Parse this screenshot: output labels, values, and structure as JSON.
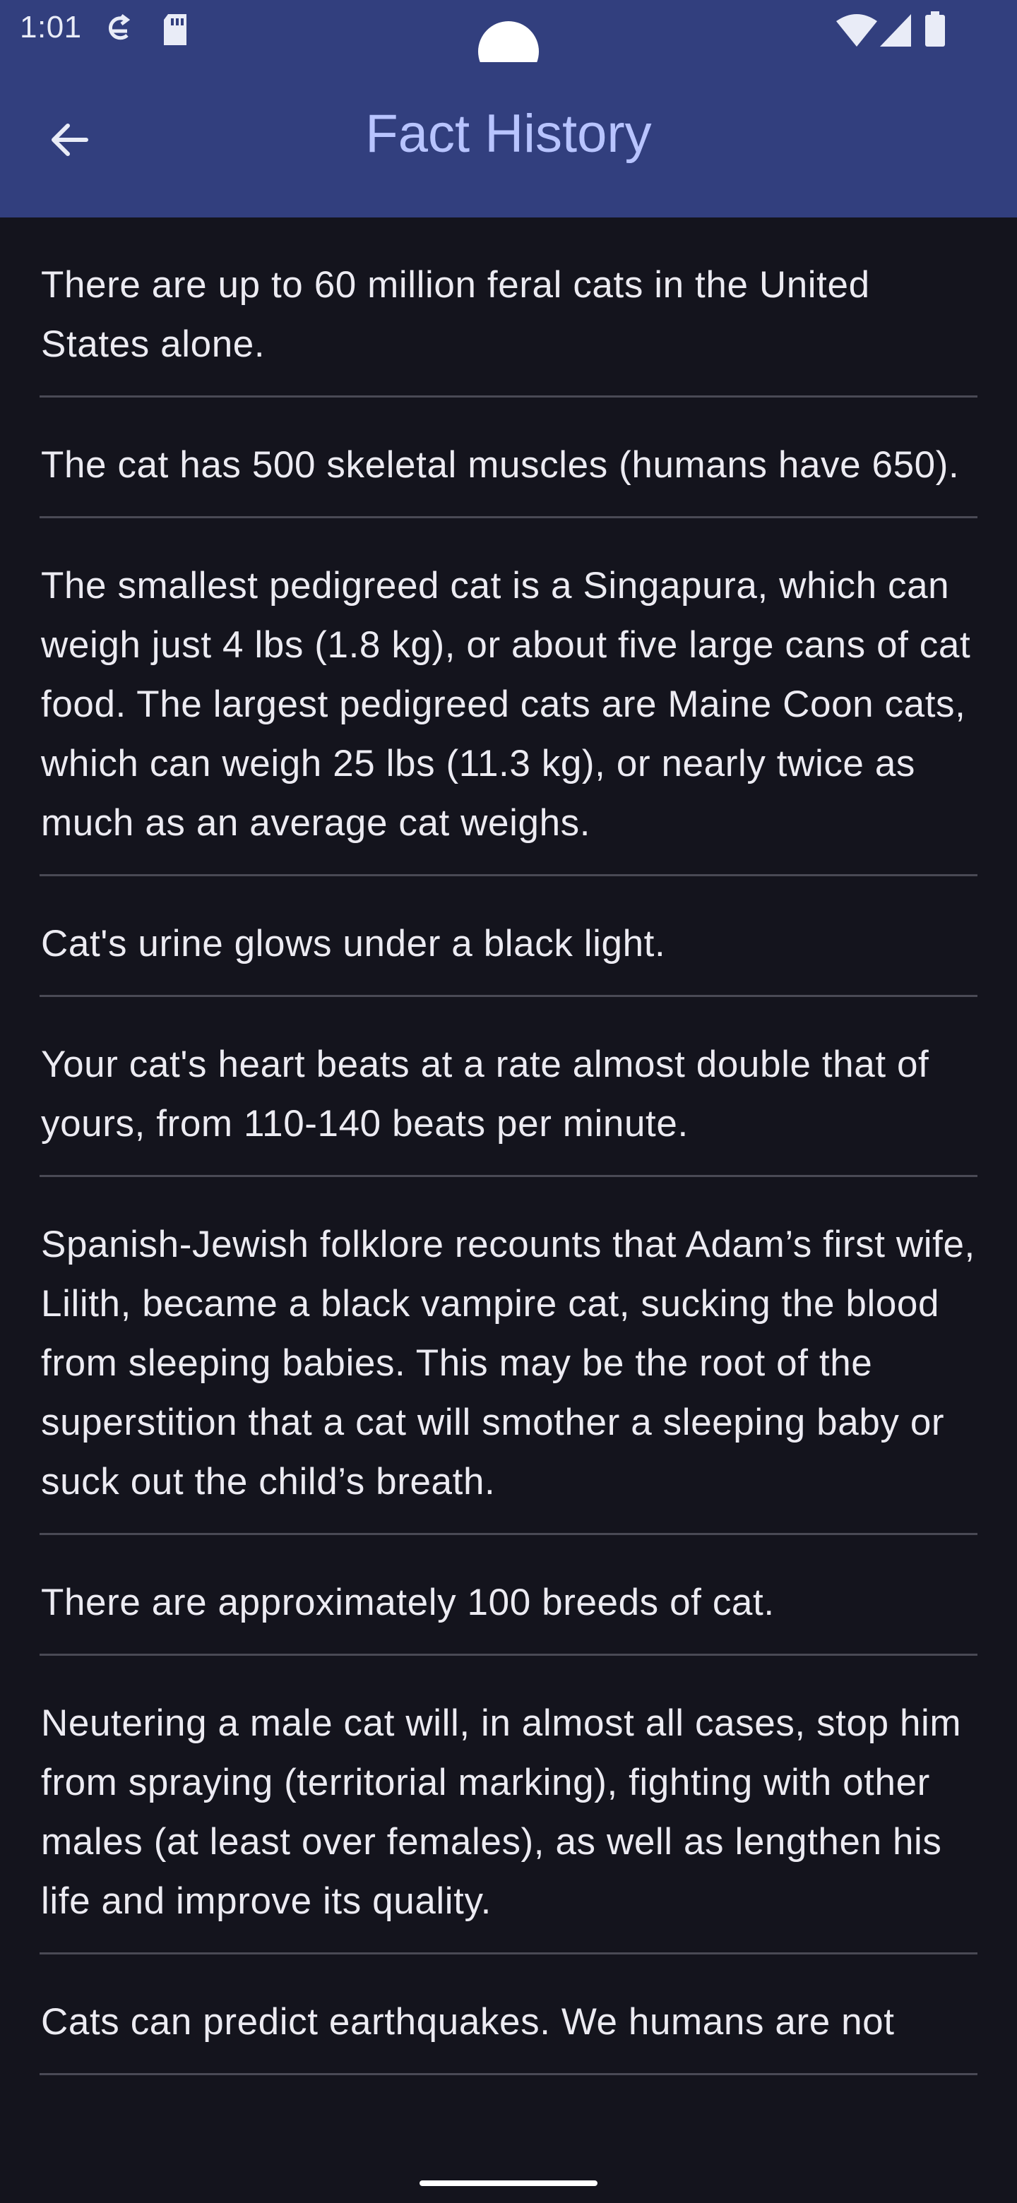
{
  "status_bar": {
    "time": "1:01",
    "icons": [
      "sync-icon",
      "sd-card-icon",
      "wifi-icon",
      "signal-icon",
      "battery-icon"
    ]
  },
  "app_bar": {
    "title": "Fact History",
    "back_icon": "arrow-back-icon"
  },
  "facts": [
    "There are up to 60 million feral cats in the United States alone.",
    "The cat has 500 skeletal muscles (humans have 650).",
    "The smallest pedigreed cat is a Singapura, which can weigh just 4 lbs (1.8 kg), or about five large cans of cat food. The largest pedigreed cats are Maine Coon cats, which can weigh 25 lbs (11.3 kg), or nearly twice as much as an average cat weighs.",
    "Cat's urine glows under a black light.",
    "Your cat's heart beats at a rate almost double that of yours, from 110-140 beats per minute.",
    "Spanish-Jewish folklore recounts that Adam’s first wife, Lilith, became a black vampire cat, sucking the blood from sleeping babies. This may be the root of the superstition that a cat will smother a sleeping baby or suck out the child’s breath.",
    "There are approximately 100 breeds of cat.",
    "Neutering a male cat will, in almost all cases, stop him from spraying (territorial marking), fighting with other males (at least over females), as well as lengthen his life and improve its quality.",
    "Cats can predict earthquakes. We humans are not"
  ],
  "colors": {
    "app_bar": "#323f7e",
    "title": "#b8c4ff",
    "background": "#14141d",
    "text": "#ecebf2",
    "divider": "#4a4a55"
  }
}
